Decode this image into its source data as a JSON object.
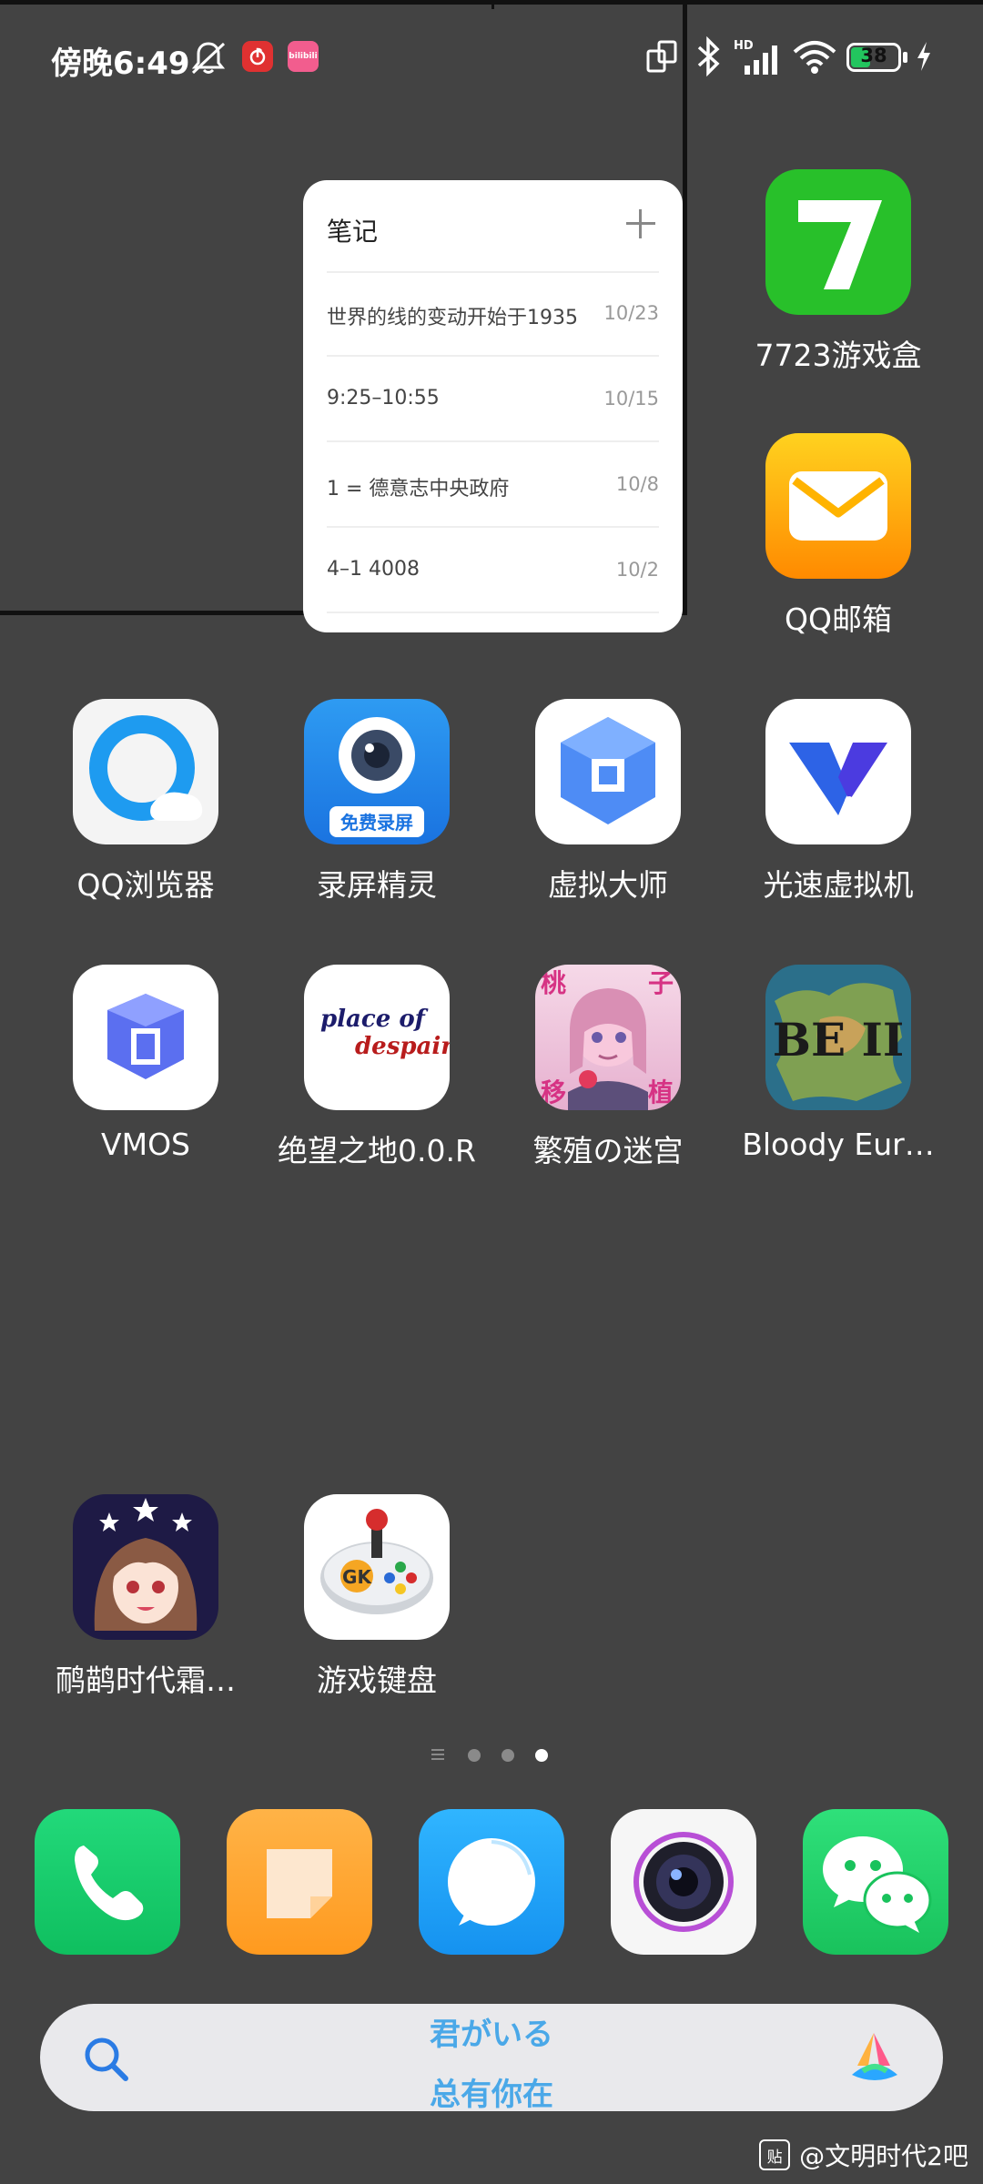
{
  "status_bar": {
    "time": "傍晚6:49",
    "battery": "38",
    "battery_level": 0.38,
    "icons": [
      "mute-icon",
      "netease-music-icon",
      "bilibili-icon",
      "rotate-icon",
      "bluetooth-icon",
      "signal-hd-icon",
      "wifi-icon",
      "battery-icon",
      "charging-icon"
    ],
    "bilibili_text": "bilibili"
  },
  "notes_widget": {
    "title": "笔记",
    "notes": [
      {
        "text": "世界的线的变动开始于1935",
        "date": "10/23"
      },
      {
        "text": "9:25–10:55",
        "date": "10/15"
      },
      {
        "text": "1 = 德意志中央政府",
        "date": "10/8"
      },
      {
        "text": "4–1 4008",
        "date": "10/2"
      }
    ]
  },
  "apps": {
    "a7723": {
      "label": "7723游戏盒"
    },
    "qqmail": {
      "label": "QQ邮箱"
    },
    "qqbrowser": {
      "label": "QQ浏览器"
    },
    "recorder": {
      "label": "录屏精灵",
      "icon_text": "免费录屏"
    },
    "vmaster": {
      "label": "虚拟大师"
    },
    "gsvm": {
      "label": "光速虚拟机"
    },
    "vmos": {
      "label": "VMOS"
    },
    "despair": {
      "label": "绝望之地0.0.R",
      "icon_text_1": "place of",
      "icon_text_2": "despair"
    },
    "maze": {
      "label": "繁殖の迷宫",
      "icon_chars": [
        "桃",
        "子",
        "移",
        "植"
      ]
    },
    "bloody": {
      "label": "Bloody Eur…",
      "icon_text": "BE II"
    },
    "era": {
      "label": "鸸鹋时代霜…"
    },
    "gamekb": {
      "label": "游戏键盘",
      "icon_text": "GK"
    }
  },
  "dock": [
    "phone-app",
    "notes-app",
    "messages-app",
    "camera-app",
    "wechat-app"
  ],
  "search_bar": {
    "line1": "君がいる",
    "line2": "总有你在"
  },
  "watermark": {
    "badge": "贴",
    "text": "@文明时代2吧"
  },
  "colors": {
    "background": "#434343",
    "accent_green": "#22c55e",
    "search_text": "#4aa8e8"
  }
}
